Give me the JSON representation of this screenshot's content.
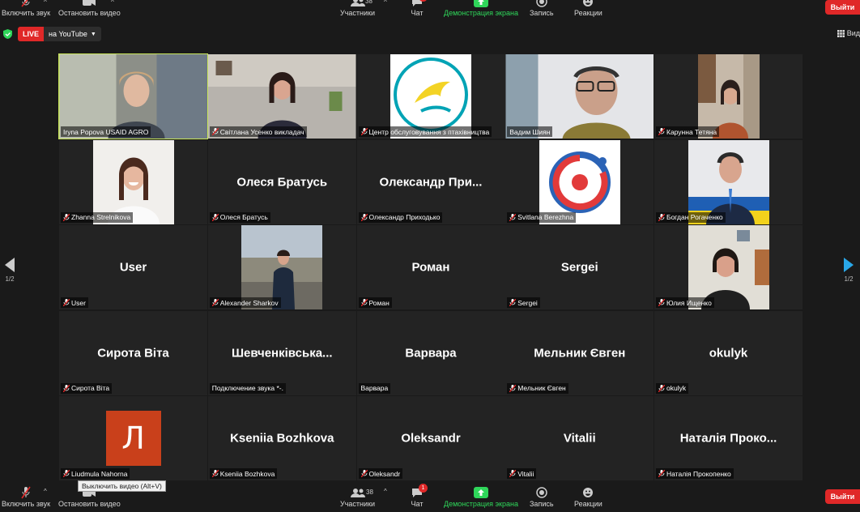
{
  "toolbar": {
    "unmute_label": "Включить звук",
    "stop_video_label": "Остановить видео",
    "participants_label": "Участники",
    "participants_count": "38",
    "chat_label": "Чат",
    "chat_badge": "1",
    "share_label": "Демонстрация экрана",
    "record_label": "Запись",
    "reactions_label": "Реакции",
    "leave_label": "Выйти",
    "tooltip": "Выключить видео (Alt+V)"
  },
  "live": {
    "tag": "LIVE",
    "destination": "на YouTube",
    "view_label": "Вид"
  },
  "paging": {
    "left": "1/2",
    "right": "1/2"
  },
  "colors": {
    "accent_green": "#2fd65a",
    "leave_red": "#e02828",
    "active_speaker": "#c9e65a"
  },
  "participants": [
    {
      "name": "Iryna Popova USAID AGRO",
      "center": "",
      "muted": false,
      "video": "person-woman-light"
    },
    {
      "name": "Світлана Усенко викладач",
      "center": "",
      "muted": true,
      "video": "person-woman-office"
    },
    {
      "name": "Центр обслуговування з птахівництва",
      "center": "",
      "muted": true,
      "video": "logo-bird"
    },
    {
      "name": "Вадим Шиян",
      "center": "",
      "muted": false,
      "video": "person-man-glasses"
    },
    {
      "name": "Карунна Тетяна",
      "center": "",
      "muted": true,
      "video": "person-woman-room"
    },
    {
      "name": "Zhanna Strelnikova",
      "center": "",
      "muted": true,
      "video": "person-woman-smile"
    },
    {
      "name": "Олеся Братусь",
      "center": "Олеся Братусь",
      "muted": true,
      "video": ""
    },
    {
      "name": "Олександр Приходько",
      "center": "Олександр  При...",
      "muted": true,
      "video": ""
    },
    {
      "name": "Svitlana Berezhna",
      "center": "",
      "muted": true,
      "video": "logo-circle"
    },
    {
      "name": "Богдан Рогаченко",
      "center": "",
      "muted": true,
      "video": "person-man-flag"
    },
    {
      "name": "User",
      "center": "User",
      "muted": true,
      "video": ""
    },
    {
      "name": "Alexander Sharkov",
      "center": "",
      "muted": true,
      "video": "person-man-city"
    },
    {
      "name": "Роман",
      "center": "Роман",
      "muted": true,
      "video": ""
    },
    {
      "name": "Sergei",
      "center": "Sergei",
      "muted": true,
      "video": ""
    },
    {
      "name": "Юлия Ищенко",
      "center": "",
      "muted": true,
      "video": "person-woman-office2"
    },
    {
      "name": "Сирота Віта",
      "center": "Сирота Віта",
      "muted": true,
      "video": ""
    },
    {
      "name": "Подключение звука *-.",
      "center": "Шевченківська...",
      "muted": false,
      "video": ""
    },
    {
      "name": "Варвара",
      "center": "Варвара",
      "muted": false,
      "video": ""
    },
    {
      "name": "Мельник Євген",
      "center": "Мельник Євген",
      "muted": true,
      "video": ""
    },
    {
      "name": "okulyk",
      "center": "okulyk",
      "muted": true,
      "video": ""
    },
    {
      "name": "Liudmula Nahorna",
      "center": "",
      "muted": true,
      "video": "avatar-letter",
      "avatar_letter": "Л"
    },
    {
      "name": "Kseniia Bozhkova",
      "center": "Kseniia Bozhkova",
      "muted": true,
      "video": ""
    },
    {
      "name": "Oleksandr",
      "center": "Oleksandr",
      "muted": true,
      "video": ""
    },
    {
      "name": "Vitalii",
      "center": "Vitalii",
      "muted": true,
      "video": ""
    },
    {
      "name": "Наталія Прокопенко",
      "center": "Наталія Проко...",
      "muted": true,
      "video": ""
    }
  ]
}
